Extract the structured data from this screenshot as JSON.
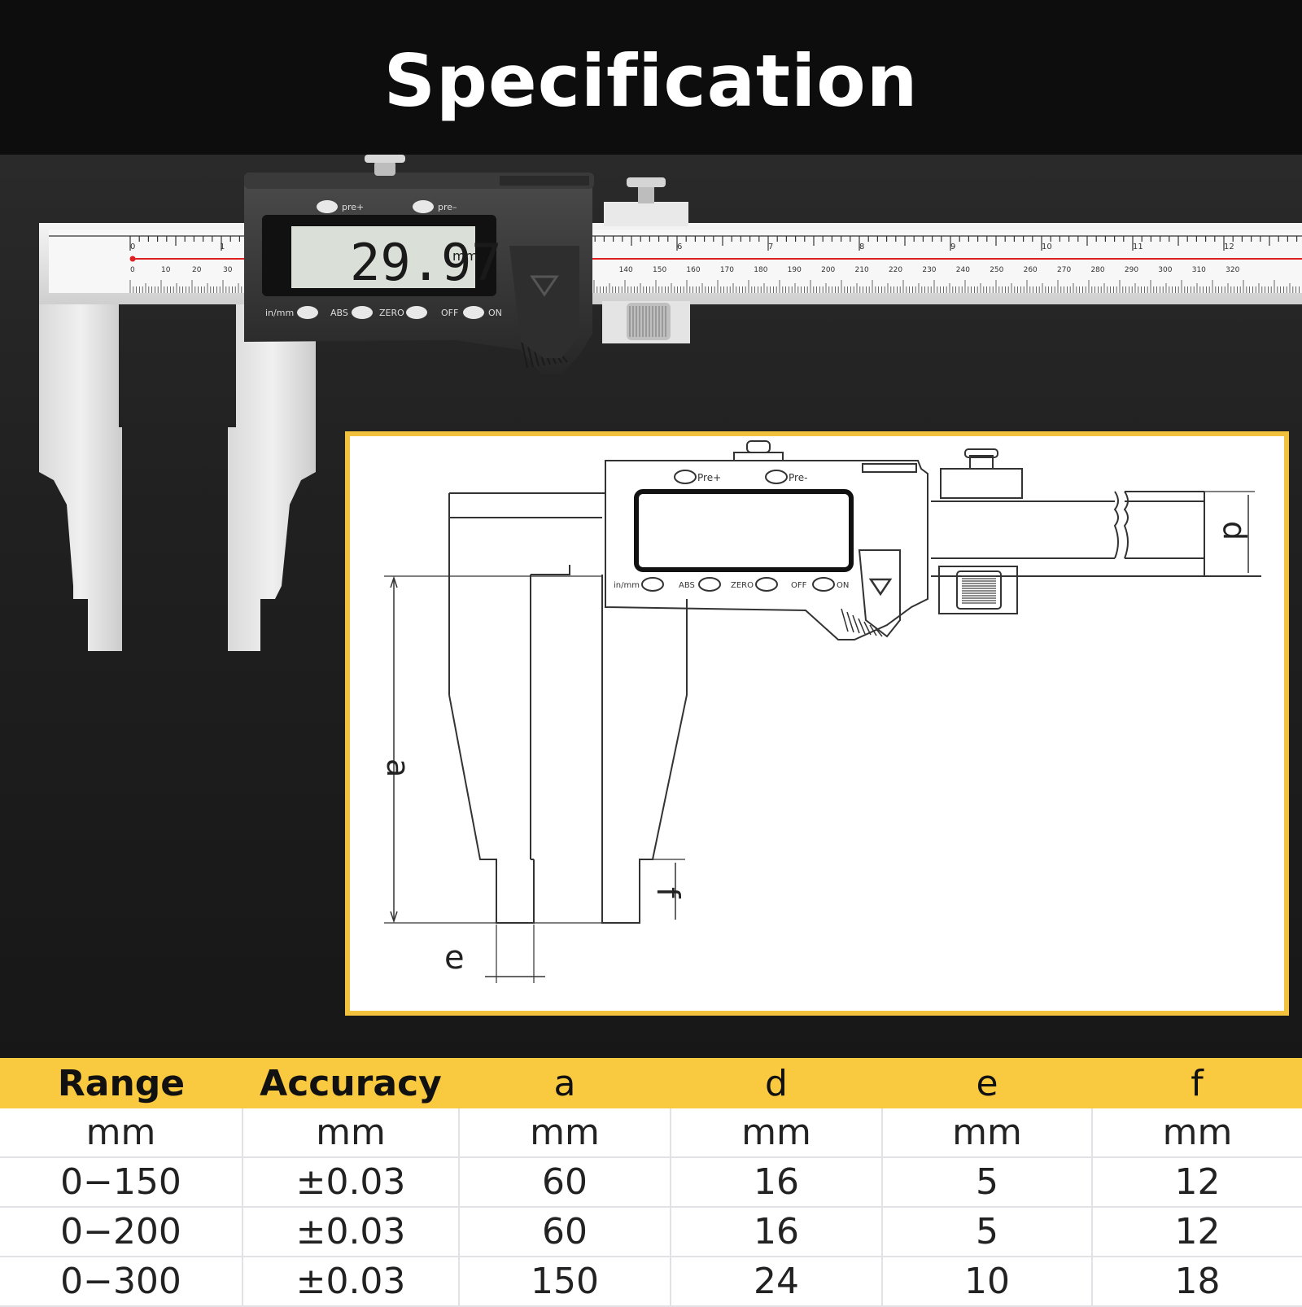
{
  "title": "Specification",
  "caliper_photo": {
    "display_reading": "29.97",
    "display_unit": "mm",
    "buttons_top": [
      "pre+",
      "pre–"
    ],
    "buttons_bottom": [
      "in/mm",
      "ABS",
      "ZERO",
      "OFF",
      "ON"
    ],
    "main_scale_labels": [
      "0",
      "1",
      "6",
      "7",
      "8",
      "9",
      "10",
      "11",
      "12"
    ],
    "lower_scale_labels": [
      "0",
      "10",
      "20",
      "30",
      "140",
      "150",
      "160",
      "170",
      "180",
      "190",
      "200",
      "210",
      "220",
      "230",
      "240",
      "250",
      "260",
      "270",
      "280",
      "290",
      "300",
      "310",
      "320"
    ]
  },
  "drawing": {
    "buttons_top": [
      "Pre+",
      "Pre-"
    ],
    "buttons_bottom": [
      "in/mm",
      "ABS",
      "ZERO",
      "OFF",
      "ON"
    ],
    "dim_a": "a",
    "dim_d": "d",
    "dim_e": "e",
    "dim_f": "f"
  },
  "table": {
    "headers": [
      "Range",
      "Accuracy",
      "a",
      "d",
      "e",
      "f"
    ],
    "units": [
      "mm",
      "mm",
      "mm",
      "mm",
      "mm",
      "mm"
    ],
    "rows": [
      [
        "0−150",
        "±0.03",
        "60",
        "16",
        "5",
        "12"
      ],
      [
        "0−200",
        "±0.03",
        "60",
        "16",
        "5",
        "12"
      ],
      [
        "0−300",
        "±0.03",
        "150",
        "24",
        "10",
        "18"
      ]
    ]
  },
  "colors": {
    "accent": "#f9c93f",
    "background": "#0d0d0d"
  }
}
